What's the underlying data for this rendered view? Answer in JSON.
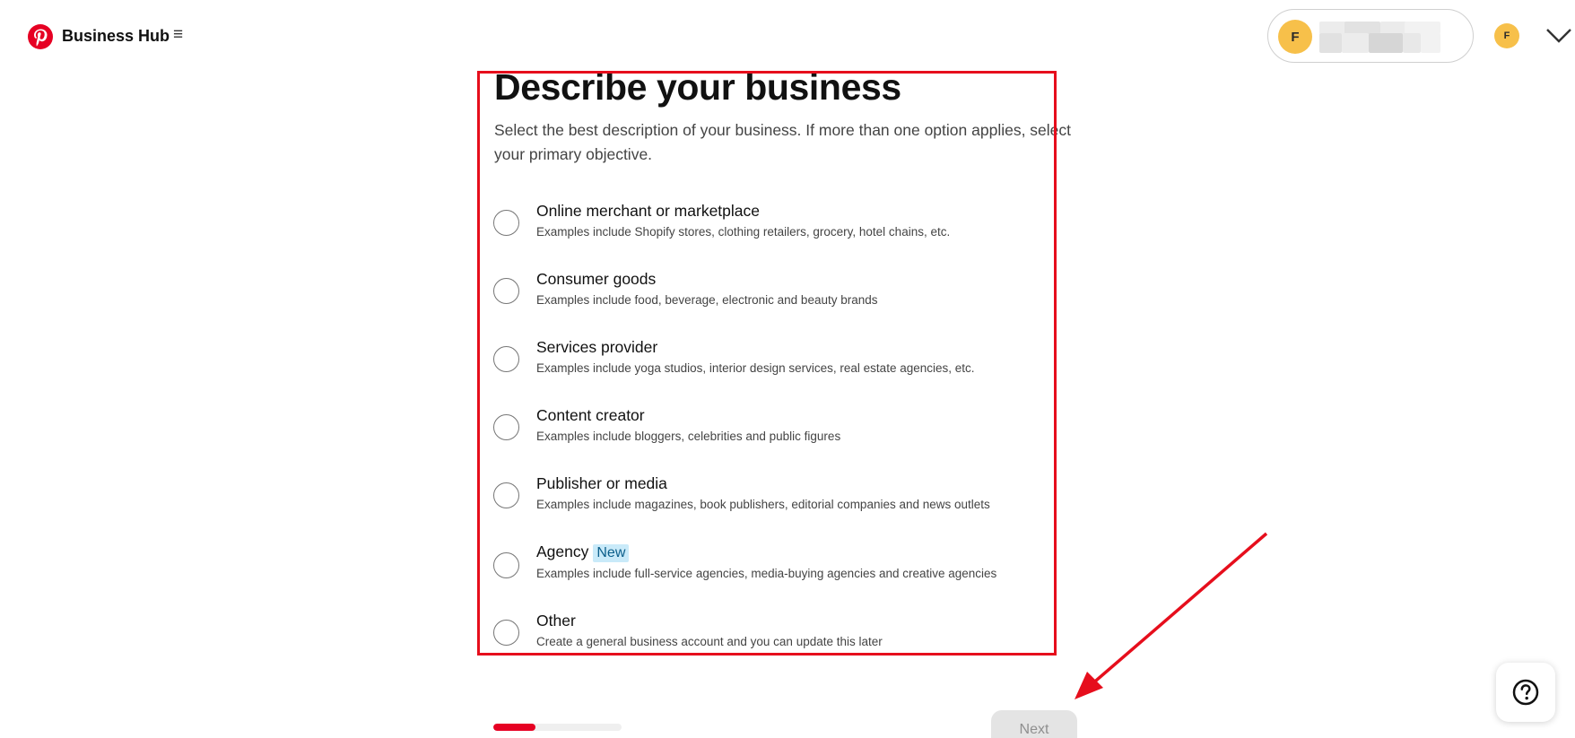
{
  "header": {
    "brand": "Business Hub",
    "menu_icon": "hamburger-icon",
    "account": {
      "avatar_initial": "F",
      "small_avatar_initial": "F"
    },
    "logo_color": "#e60023"
  },
  "page": {
    "title": "Describe your business",
    "subtitle": "Select the best description of your business. If more than one option applies, select your primary objective."
  },
  "options": [
    {
      "label": "Online merchant or marketplace",
      "description": "Examples include Shopify stores, clothing retailers, grocery, hotel chains, etc."
    },
    {
      "label": "Consumer goods",
      "description": "Examples include food, beverage, electronic and beauty brands"
    },
    {
      "label": "Services provider",
      "description": "Examples include yoga studios, interior design services, real estate agencies, etc."
    },
    {
      "label": "Content creator",
      "description": "Examples include bloggers, celebrities and public figures"
    },
    {
      "label": "Publisher or media",
      "description": "Examples include magazines, book publishers, editorial companies and news outlets"
    },
    {
      "label": "Agency",
      "badge": "New",
      "description": "Examples include full-service agencies, media-buying agencies and creative agencies"
    },
    {
      "label": "Other",
      "description": "Create a general business account and you can update this later"
    }
  ],
  "footer": {
    "progress": 0.33,
    "next_label": "Next",
    "help_icon": "help-icon"
  },
  "colors": {
    "accent": "#e60023",
    "annotation_red": "#e60e1c",
    "avatar": "#f7c04a",
    "badge_bg": "#c9eaf9"
  }
}
